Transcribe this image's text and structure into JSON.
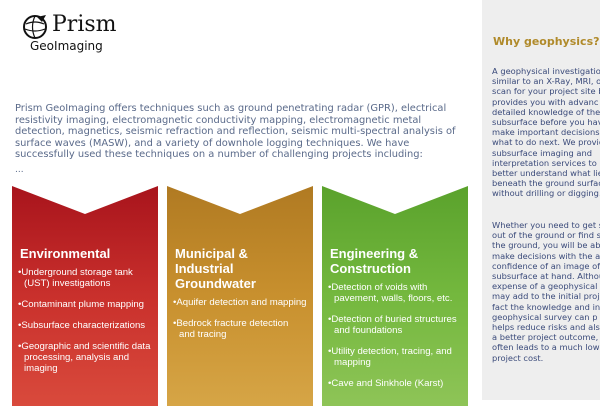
{
  "logo": {
    "name": "Prism",
    "sub": "GeoImaging"
  },
  "intro": {
    "text": "Prism GeoImaging offers techniques such as ground penetrating radar (GPR), electrical resistivity imaging, electromagnetic conductivity mapping, electromagnetic metal detection, magnetics, seismic refraction and reflection, seismic multi-spectral analysis of surface waves (MASW), and a variety of downhole logging techniques. We have successfully used these techniques on a number of challenging projects including:",
    "ellipsis": "..."
  },
  "cards": [
    {
      "title": "Environmental",
      "color": "#c1272d",
      "items": [
        "Underground storage tank (UST) investigations",
        "Contaminant plume mapping",
        "Subsurface characterizations",
        "Geographic and scientific data processing, analysis and imaging"
      ]
    },
    {
      "title": "Municipal & Industrial Groundwater",
      "color": "#c08a2a",
      "items": [
        "Aquifer detection and mapping",
        "Bedrock fracture detection and tracing"
      ]
    },
    {
      "title": "Engineering & Construction",
      "color": "#6ab13a",
      "items": [
        "Detection of voids with pavement, walls, floors, etc.",
        "Detection of buried structures and foundations",
        "Utility detection, tracing, and mapping",
        "Cave and Sinkhole (Karst)"
      ]
    }
  ],
  "sidebar": {
    "title": "Why geophysics?",
    "para1": "A geophysical investigation similar to an X-Ray, MRI, or scan for your project site b it provides you with advanc detailed knowledge of the subsurface before you hav make important decisions ab what to do next. We provide subsurface imaging and interpretation services to he better understand what lies beneath the ground surface without drilling or digging.",
    "para2": "Whether you need to get so out of the ground or find so in the ground, you will be ab make decisions with the add confidence of an image of t subsurface at hand. Althoug expense of a geophysical su may add to the initial project fact the knowledge and info a geophysical survey can p helps reduce risks and also in a better project outcome, often leads to a much lower project cost."
  }
}
